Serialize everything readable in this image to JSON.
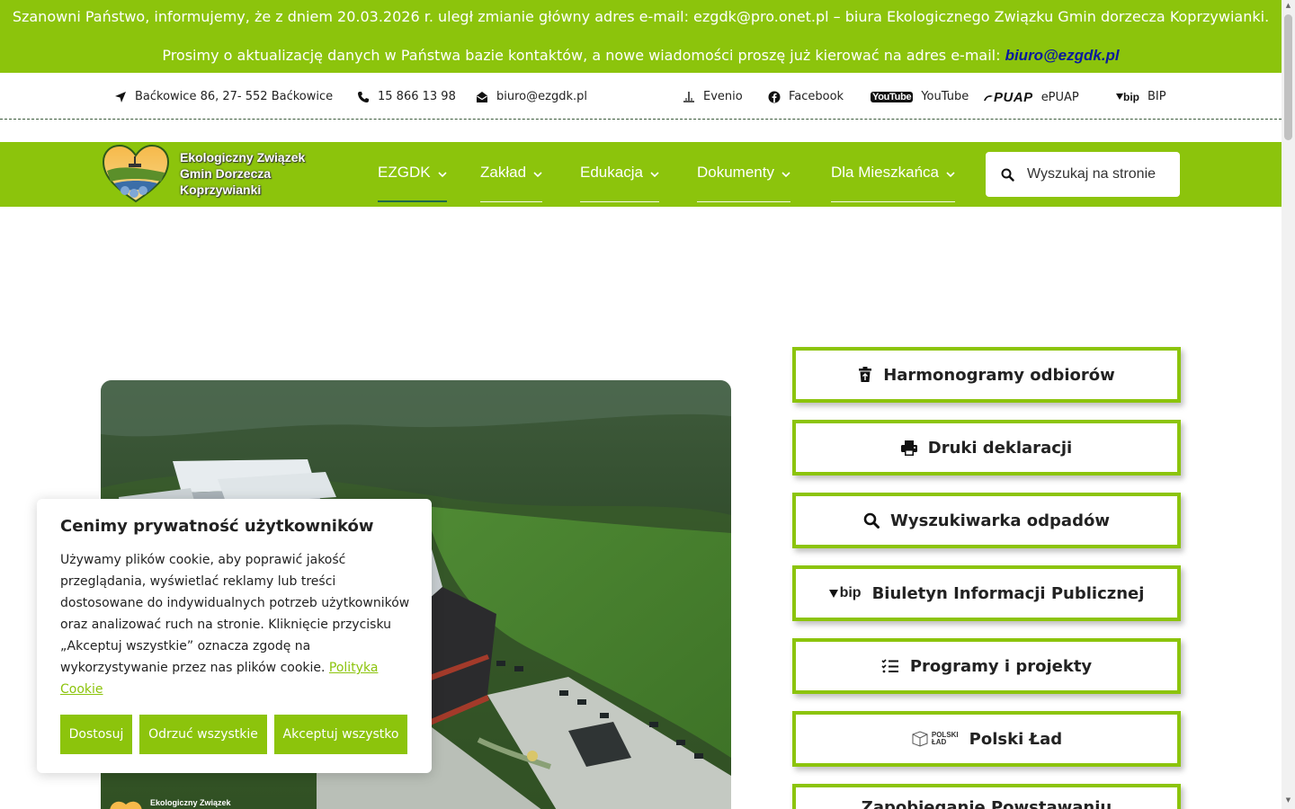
{
  "notice": {
    "line1": "Szanowni Państwo, informujemy, że z dniem 20.03.2026 r. uległ zmianie główny adres e-mail: ezgdk@pro.onet.pl – biura Ekologicznego Związku Gmin dorzecza Koprzywianki.",
    "line2_prefix": "Prosimy o aktualizację danych w Państwa bazie kontaktów, a nowe wiadomości proszę już kierować na adres e-mail: ",
    "line2_email": "biuro@ezgdk.pl"
  },
  "topbar": {
    "address": "Baćkowice 86, 27- 552 Baćkowice",
    "phone": "15 866 13 98",
    "email": "biuro@ezgdk.pl",
    "links": {
      "evenio": "Evenio",
      "facebook": "Facebook",
      "youtube": "YouTube",
      "epuap": "ePUAP",
      "bip": "BIP"
    },
    "youtube_logo_text": "YouTube",
    "epuap_logo_text": "PUAP",
    "bip_logo_text": "bip"
  },
  "logo": {
    "line1": "Ekologiczny Związek",
    "line2": "Gmin Dorzecza",
    "line3": "Koprzywianki"
  },
  "menu": [
    {
      "label": "EZGDK"
    },
    {
      "label": "Zakład"
    },
    {
      "label": "Edukacja"
    },
    {
      "label": "Dokumenty"
    },
    {
      "label": "Dla Mieszkańca"
    }
  ],
  "search": {
    "placeholder": "Wyszukaj na stronie"
  },
  "photo": {
    "watermark_line1": "Ekologiczny Związek"
  },
  "side_buttons": [
    {
      "label": "Harmonogramy odbiorów",
      "icon": "trash-icon"
    },
    {
      "label": "Druki deklaracji",
      "icon": "printer-icon"
    },
    {
      "label": "Wyszukiwarka odpadów",
      "icon": "search-icon"
    },
    {
      "label": "Biuletyn Informacji Publicznej",
      "icon": "bip-icon"
    },
    {
      "label": "Programy i projekty",
      "icon": "list-check-icon"
    },
    {
      "label": "Polski Ład",
      "icon": "polski-lad-icon"
    },
    {
      "label": "Zapobieganie Powstawaniu",
      "icon": ""
    }
  ],
  "polski_lad_logo": {
    "line1": "POLSKI",
    "line2": "ŁAD"
  },
  "cookie": {
    "title": "Cenimy prywatność użytkowników",
    "text": "Używamy plików cookie, aby poprawić jakość przeglądania, wyświetlać reklamy lub treści dostosowane do indywidualnych potrzeb użytkowników oraz analizować ruch na stronie. Kliknięcie przycisku „Akceptuj wszystkie” oznacza zgodę na wykorzystywanie przez nas plików cookie. ",
    "policy_link": "Polityka Cookie",
    "btn_customize": "Dostosuj",
    "btn_reject": "Odrzuć wszystkie",
    "btn_accept": "Akceptuj wszystko"
  },
  "colors": {
    "brand_green": "#8cc40c",
    "notice_link": "#0a1a9c",
    "active_underline": "#1f6b4a"
  }
}
